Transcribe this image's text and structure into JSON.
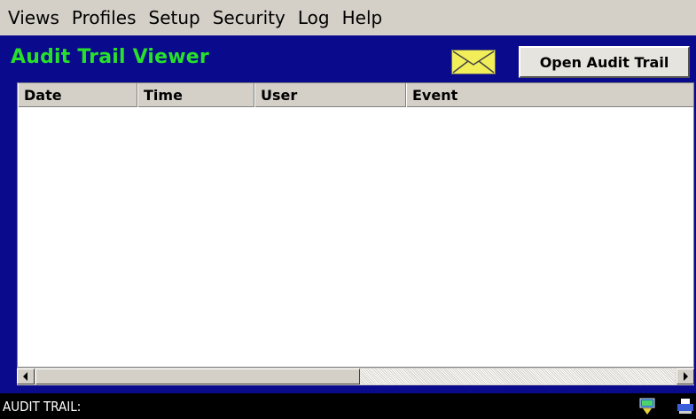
{
  "menu": {
    "items": [
      {
        "label": "Views"
      },
      {
        "label": "Profiles"
      },
      {
        "label": "Setup"
      },
      {
        "label": "Security"
      },
      {
        "label": "Log"
      },
      {
        "label": "Help"
      }
    ]
  },
  "header": {
    "title": "Audit Trail Viewer",
    "mail_icon": "envelope-icon",
    "open_button_label": "Open Audit Trail"
  },
  "table": {
    "columns": [
      "Date",
      "Time",
      "User",
      "Event"
    ],
    "rows": []
  },
  "status_bar": {
    "text": "AUDIT TRAIL:",
    "icons": [
      "network-icon",
      "printer-icon"
    ]
  },
  "colors": {
    "frame_background": "#0a0a8c",
    "title_green": "#27e02a",
    "menu_background": "#d4d0c8",
    "status_background": "#000000"
  }
}
